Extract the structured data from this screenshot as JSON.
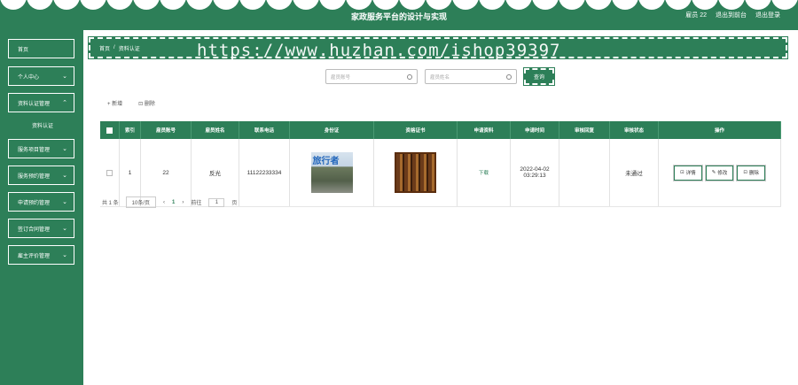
{
  "header": {
    "title": "家政服务平台的设计与实现",
    "user_label": "雇员 22",
    "back_label": "退出到前台",
    "logout_label": "退出登录"
  },
  "sidebar": {
    "items": [
      {
        "label": "首页",
        "expandable": false
      },
      {
        "label": "个人中心",
        "expandable": true
      },
      {
        "label": "资料认证管理",
        "expandable": true
      },
      {
        "label": "服务项目管理",
        "expandable": true
      },
      {
        "label": "服务预约管理",
        "expandable": true
      },
      {
        "label": "申请预约管理",
        "expandable": true
      },
      {
        "label": "签订合同管理",
        "expandable": true
      },
      {
        "label": "雇主评价管理",
        "expandable": true
      }
    ],
    "subitem": "资料认证"
  },
  "breadcrumb": {
    "home": "首页",
    "separator": "/",
    "current": "资料认证",
    "watermark": "https://www.huzhan.com/ishop39397"
  },
  "search": {
    "account_placeholder": "雇员账号",
    "name_placeholder": "雇员姓名",
    "query_label": "查询"
  },
  "actions": {
    "add_label": "+ 新增",
    "delete_label": "⊡ 删除"
  },
  "table": {
    "columns": [
      "索引",
      "雇员账号",
      "雇员姓名",
      "联系电话",
      "身份证",
      "资格证书",
      "申请资料",
      "申请时间",
      "审核回复",
      "审核状态",
      "操作"
    ],
    "rows": [
      {
        "index": "1",
        "account": "22",
        "name": "反光",
        "phone": "11122233334",
        "id_image_text": "旅行者",
        "application": "下载",
        "time": "2022-04-02 03:29:13",
        "reply": "",
        "status": "未通过",
        "ops": {
          "detail": "详情",
          "edit": "修改",
          "delete": "删除"
        }
      }
    ]
  },
  "pager": {
    "total": "共 1 条",
    "page_size": "10条/页",
    "prev": "‹",
    "page": "1",
    "next": "›",
    "goto_label": "前往",
    "goto_value": "1",
    "page_suffix": "页"
  },
  "colors": {
    "primary": "#2d7f58"
  }
}
